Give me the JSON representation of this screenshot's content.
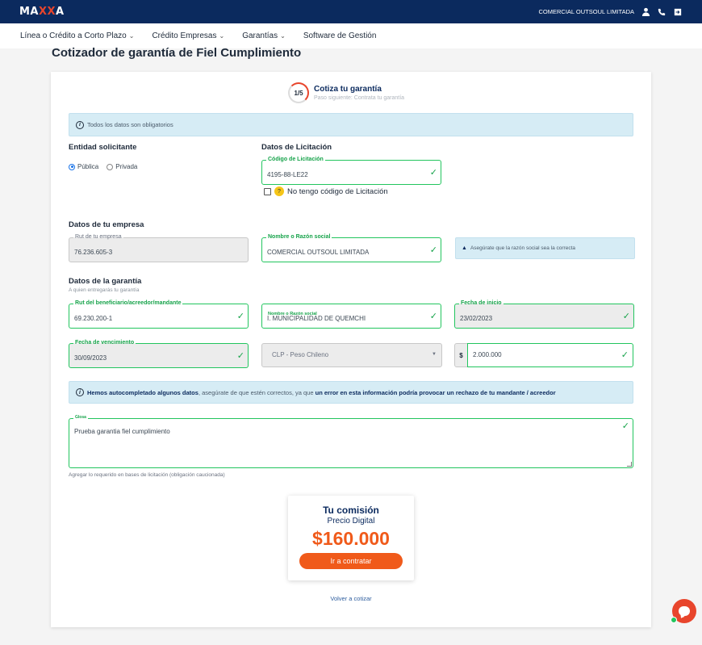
{
  "header": {
    "logo_text": "MAXXA",
    "company": "COMERCIAL OUTSOUL LIMITADA",
    "icons": [
      "user-icon",
      "phone-icon",
      "logout-icon"
    ]
  },
  "nav": {
    "items": [
      {
        "label": "Línea o Crédito a Corto Plazo",
        "has_dropdown": true
      },
      {
        "label": "Crédito Empresas",
        "has_dropdown": true
      },
      {
        "label": "Garantías",
        "has_dropdown": true
      },
      {
        "label": "Software de Gestión",
        "has_dropdown": false
      }
    ]
  },
  "page": {
    "title": "Cotizador de garantía de Fiel Cumplimiento"
  },
  "step": {
    "counter": "1/5",
    "title": "Cotiza tu garantía",
    "next": "Paso siguiente: Contrata tu garantía"
  },
  "info_required": "Todos los datos son obligatorios",
  "entidad": {
    "title": "Entidad solicitante",
    "options": [
      "Pública",
      "Privada"
    ],
    "selected": "Pública"
  },
  "licitacion": {
    "title": "Datos de Licitación",
    "code_label": "Código de Licitación",
    "code_value": "4195-88-LE22",
    "no_code_label": "No tengo código de Licitación"
  },
  "empresa": {
    "title": "Datos de tu empresa",
    "rut_label": "Rut de tu empresa",
    "rut_value": "76.236.605-3",
    "razon_label": "Nombre o Razón social",
    "razon_value": "COMERCIAL OUTSOUL LIMITADA",
    "note": "Asegúrate que la razón social sea la correcta"
  },
  "garantia": {
    "title": "Datos de la garantía",
    "subtitle": "A quien entregarás tu garantía",
    "rut_benef_label": "Rut del beneficiario/acreedor/mandante",
    "rut_benef_value": "69.230.200-1",
    "razon_label": "Nombre o Razón social",
    "razon_value": "I. MUNICIPALIDAD DE QUEMCHI",
    "inicio_label": "Fecha de inicio",
    "inicio_value": "23/02/2023",
    "venc_label": "Fecha de vencimiento",
    "venc_value": "30/09/2023",
    "currency_select": "CLP - Peso Chileno",
    "currency_symbol": "$",
    "amount": "2.000.000"
  },
  "autocomplete": {
    "bold1": "Hemos autocompletado algunos datos",
    "mid": ", asegúrate de que estén correctos, ya que ",
    "bold2": "un error en esta información podría provocar un rechazo de tu mandante / acreedor"
  },
  "glosa": {
    "label": "Glosa",
    "value": "Prueba garantia fiel cumplimiento",
    "helper": "Agregar lo requerido en bases de licitación (obligación caucionada)"
  },
  "commission": {
    "title": "Tu comisión",
    "subtitle": "Precio Digital",
    "price": "$160.000",
    "button": "Ir a contratar"
  },
  "back_link": "Volver a cotizar",
  "colors": {
    "header_bg": "#0b2a5e",
    "accent": "#f05a1a",
    "valid": "#22c55e",
    "info_bg": "#d6ecf5"
  }
}
